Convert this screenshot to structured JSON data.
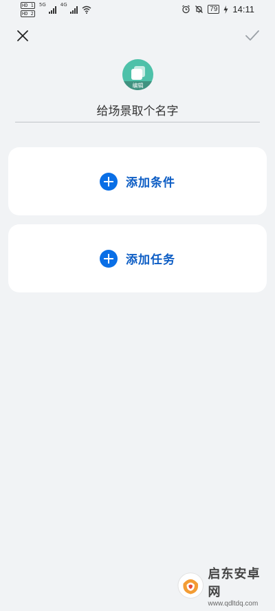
{
  "status_bar": {
    "sim1_tag": "HD 1",
    "sim2_tag": "HD 2",
    "sim1_network": "5G",
    "sim2_network": "4G",
    "battery": "79",
    "time": "14:11"
  },
  "header": {
    "close_icon": "close-icon",
    "confirm_icon": "check-icon"
  },
  "avatar": {
    "edit_label": "编辑",
    "color": "#4ec1a9"
  },
  "scene_name": {
    "placeholder": "给场景取个名字",
    "value": ""
  },
  "cards": {
    "condition_label": "添加条件",
    "task_label": "添加任务"
  },
  "watermark": {
    "title": "启东安卓网",
    "url": "www.qdltdq.com"
  },
  "colors": {
    "background": "#f1f3f5",
    "accent": "#0a6fe6",
    "accent_text": "#0b5cc4",
    "card": "#ffffff"
  }
}
